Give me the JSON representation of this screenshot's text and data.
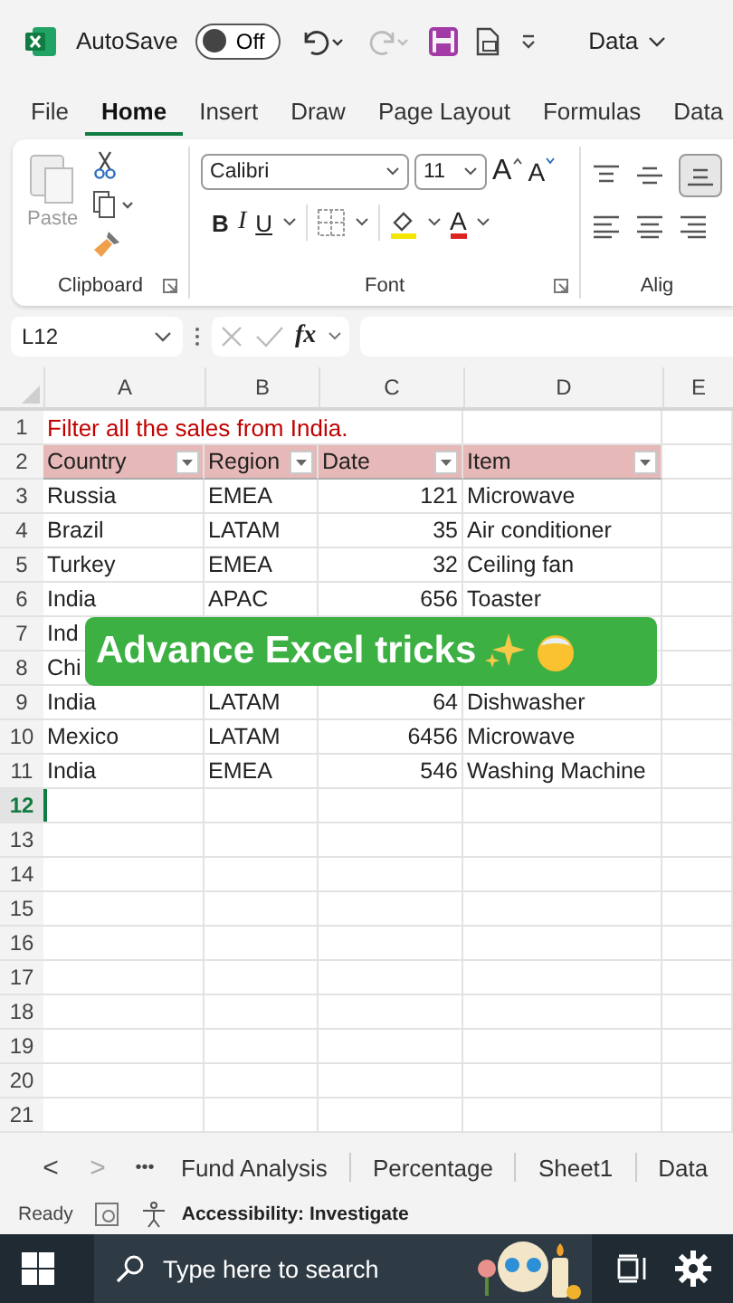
{
  "titlebar": {
    "autosave_label": "AutoSave",
    "autosave": {
      "label": "Off",
      "on": false
    },
    "file_name": "Data"
  },
  "menu_tabs": [
    {
      "label": "File",
      "selected": false
    },
    {
      "label": "Home",
      "selected": true
    },
    {
      "label": "Insert",
      "selected": false
    },
    {
      "label": "Draw",
      "selected": false
    },
    {
      "label": "Page Layout",
      "selected": false
    },
    {
      "label": "Formulas",
      "selected": false
    },
    {
      "label": "Data",
      "selected": false
    }
  ],
  "ribbon": {
    "paste_label": "Paste",
    "font_name": "Calibri",
    "font_size": "11",
    "grow_font": "A",
    "shrink_font": "A",
    "bold": "B",
    "italic": "I",
    "underline": "U",
    "font_color": "A",
    "groups": [
      "Clipboard",
      "Font",
      "Alig"
    ]
  },
  "formula_bar": {
    "name_box": "L12",
    "fx": "fx"
  },
  "sheet": {
    "columns": [
      "A",
      "B",
      "C",
      "D",
      "E"
    ],
    "rows": [
      {
        "number": "1",
        "kind": "note",
        "selected": false,
        "cells": [
          "Filter all the sales from India."
        ]
      },
      {
        "number": "2",
        "kind": "header",
        "selected": false,
        "cells": [
          "Country",
          "Region",
          "Date",
          "Item"
        ]
      },
      {
        "number": "3",
        "kind": "data",
        "selected": false,
        "cells": [
          "Russia",
          "EMEA",
          "121",
          "Microwave"
        ]
      },
      {
        "number": "4",
        "kind": "data",
        "selected": false,
        "cells": [
          "Brazil",
          "LATAM",
          "35",
          "Air conditioner"
        ]
      },
      {
        "number": "5",
        "kind": "data",
        "selected": false,
        "cells": [
          "Turkey",
          "EMEA",
          "32",
          "Ceiling fan"
        ]
      },
      {
        "number": "6",
        "kind": "data",
        "selected": false,
        "cells": [
          "India",
          "APAC",
          "656",
          "Toaster"
        ]
      },
      {
        "number": "7",
        "kind": "data",
        "selected": false,
        "cells": [
          "Ind"
        ]
      },
      {
        "number": "8",
        "kind": "data",
        "selected": false,
        "cells": [
          "Chi"
        ]
      },
      {
        "number": "9",
        "kind": "data",
        "selected": false,
        "cells": [
          "India",
          "LATAM",
          "64",
          "Dishwasher"
        ]
      },
      {
        "number": "10",
        "kind": "data",
        "selected": false,
        "cells": [
          "Mexico",
          "LATAM",
          "6456",
          "Microwave"
        ]
      },
      {
        "number": "11",
        "kind": "data",
        "selected": false,
        "cells": [
          "India",
          "EMEA",
          "546",
          "Washing Machine"
        ]
      },
      {
        "number": "12",
        "kind": "empty",
        "selected": true,
        "cells": []
      },
      {
        "number": "13",
        "kind": "empty",
        "selected": false,
        "cells": []
      },
      {
        "number": "14",
        "kind": "empty",
        "selected": false,
        "cells": []
      },
      {
        "number": "15",
        "kind": "empty",
        "selected": false,
        "cells": []
      },
      {
        "number": "16",
        "kind": "empty",
        "selected": false,
        "cells": []
      },
      {
        "number": "17",
        "kind": "empty",
        "selected": false,
        "cells": []
      },
      {
        "number": "18",
        "kind": "empty",
        "selected": false,
        "cells": []
      },
      {
        "number": "19",
        "kind": "empty",
        "selected": false,
        "cells": []
      },
      {
        "number": "20",
        "kind": "empty",
        "selected": false,
        "cells": []
      },
      {
        "number": "21",
        "kind": "empty",
        "selected": false,
        "cells": []
      }
    ]
  },
  "overlay": {
    "caption": "Advance Excel tricks"
  },
  "sheet_tabs": {
    "prev": "<",
    "next": ">",
    "more": "•••",
    "tabs": [
      {
        "label": "Fund Analysis",
        "selected": false
      },
      {
        "label": "Percentage",
        "selected": false
      },
      {
        "label": "Sheet1",
        "selected": false
      },
      {
        "label": "Data",
        "selected": false
      }
    ]
  },
  "status_bar": {
    "status": "Ready",
    "accessibility": "Accessibility: Investigate"
  },
  "taskbar": {
    "search_placeholder": "Type here to search"
  }
}
